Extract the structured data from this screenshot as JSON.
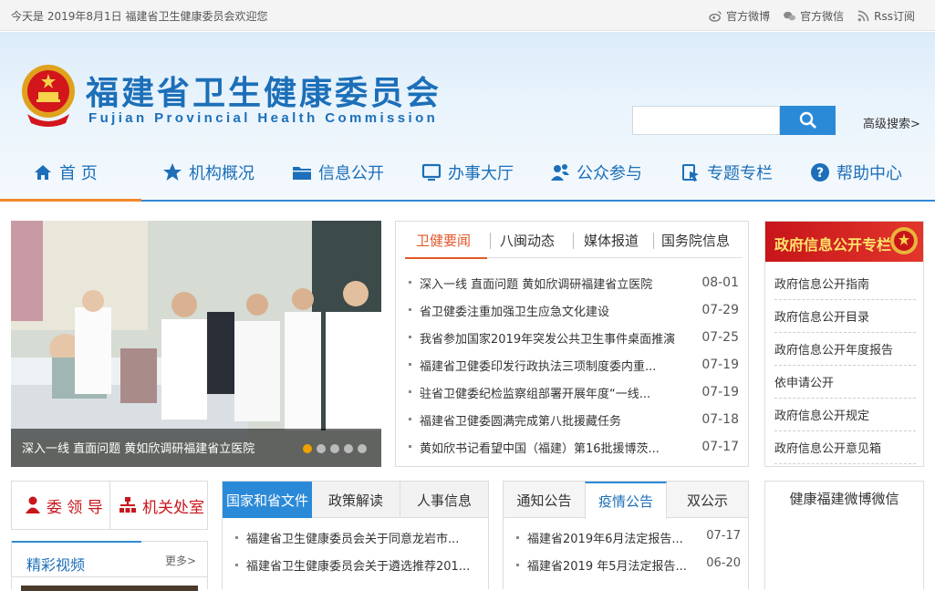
{
  "topbar": {
    "welcome": "今天是 2019年8月1日 福建省卫生健康委员会欢迎您",
    "weibo": "官方微博",
    "weixin": "官方微信",
    "rss": "Rss订阅"
  },
  "header": {
    "title": "福建省卫生健康委员会",
    "subtitle": "Fujian Provincial Health Commission",
    "search_placeholder": "",
    "advanced_search": "高级搜索>"
  },
  "nav": {
    "items": [
      {
        "label": "首 页",
        "icon": "home-icon"
      },
      {
        "label": "机构概况",
        "icon": "star-icon"
      },
      {
        "label": "信息公开",
        "icon": "folder-icon"
      },
      {
        "label": "办事大厅",
        "icon": "monitor-icon"
      },
      {
        "label": "公众参与",
        "icon": "people-icon"
      },
      {
        "label": "专题专栏",
        "icon": "tag-icon"
      },
      {
        "label": "帮助中心",
        "icon": "help-icon"
      }
    ],
    "active_index": 0
  },
  "slider": {
    "caption": "深入一线 直面问题 黄如欣调研福建省立医院",
    "dot_count": 5,
    "active_dot": 0
  },
  "news": {
    "tabs": [
      "卫健要闻",
      "八闽动态",
      "媒体报道",
      "国务院信息"
    ],
    "active_tab": 0,
    "items": [
      {
        "title": "深入一线 直面问题 黄如欣调研福建省立医院",
        "date": "08-01"
      },
      {
        "title": "省卫健委注重加强卫生应急文化建设",
        "date": "07-29"
      },
      {
        "title": "我省参加国家2019年突发公共卫生事件桌面推演",
        "date": "07-25"
      },
      {
        "title": "福建省卫健委印发行政执法三项制度委内重...",
        "date": "07-19"
      },
      {
        "title": "驻省卫健委纪检监察组部署开展年度“一线...",
        "date": "07-19"
      },
      {
        "title": "福建省卫健委圆满完成第八批援藏任务",
        "date": "07-18"
      },
      {
        "title": "黄如欣书记看望中国（福建）第16批援博茨...",
        "date": "07-17"
      }
    ]
  },
  "gov": {
    "title": "政府信息公开专栏",
    "items": [
      "政府信息公开指南",
      "政府信息公开目录",
      "政府信息公开年度报告",
      "依申请公开",
      "政府信息公开规定",
      "政府信息公开意见箱"
    ]
  },
  "leaders": {
    "leaders_label": "委 领 导",
    "offices_label": "机关处室"
  },
  "video": {
    "title": "精彩视频",
    "more": "更多>"
  },
  "docs": {
    "tabs": [
      "国家和省文件",
      "政策解读",
      "人事信息"
    ],
    "active_tab": 0,
    "items": [
      "福建省卫生健康委员会关于同意龙岩市...",
      "福建省卫生健康委员会关于遴选推荐201..."
    ]
  },
  "notices": {
    "tabs": [
      "通知公告",
      "疫情公告",
      "双公示"
    ],
    "active_tab": 1,
    "items": [
      {
        "title": "福建省2019年6月法定报告...",
        "date": "07-17"
      },
      {
        "title": "福建省2019 年5月法定报告...",
        "date": "06-20"
      }
    ]
  },
  "weibo": {
    "title": "健康福建微博微信"
  },
  "colors": {
    "brand_blue": "#1c6fb8",
    "accent_orange": "#f0882a",
    "gov_red": "#c7151a"
  }
}
